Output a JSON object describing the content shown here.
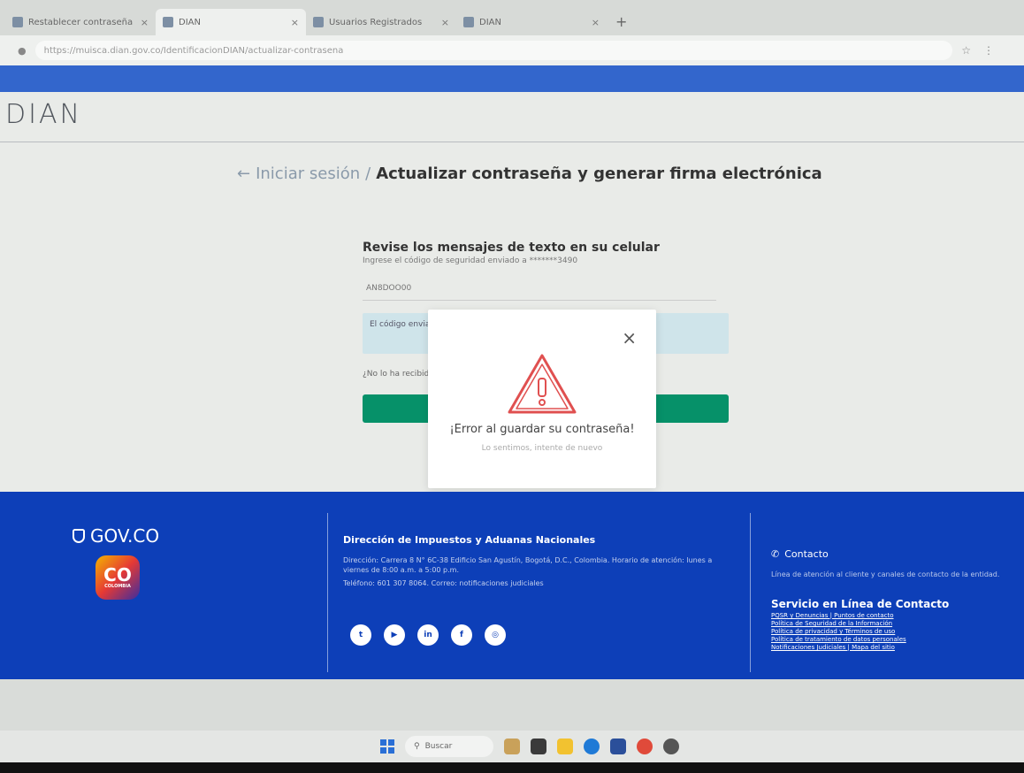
{
  "browser": {
    "tabs": [
      {
        "title": "Restablecer contraseña - DIAN"
      },
      {
        "title": "DIAN"
      },
      {
        "title": "Usuarios Registrados"
      },
      {
        "title": "DIAN"
      }
    ],
    "url": "https://muisca.dian.gov.co/IdentificacionDIAN/actualizar-contrasena"
  },
  "site": {
    "logo": "DIAN"
  },
  "breadcrumb": {
    "back_arrow": "←",
    "back_label": "Iniciar sesión",
    "separator": "/",
    "current": "Actualizar contraseña y generar firma electrónica"
  },
  "form": {
    "title": "Revise los mensajes de texto en su celular",
    "hint": "Ingrese el código de seguridad enviado a *******3490",
    "code_placeholder": "AN8DOO00",
    "info_text": "El código enviado a su celular tiene una vigencia limitada.",
    "resend_text": "¿No lo ha recibido?"
  },
  "modal": {
    "close": "×",
    "icon": "warning-triangle-icon",
    "title": "¡Error al guardar su contraseña!",
    "subtitle": "Lo sentimos, intente de nuevo"
  },
  "footer": {
    "gov_logo": "GOV.CO",
    "co_badge": "CO",
    "co_badge_sub": "COLOMBIA",
    "entity_title": "Dirección de Impuestos y Aduanas Nacionales",
    "entity_text_1": "Dirección: Carrera 8 N° 6C-38 Edificio San Agustín, Bogotá, D.C., Colombia. Horario de atención: lunes a viernes de 8:00 a.m. a 5:00 p.m.",
    "entity_text_2": "Teléfono: 601 307 8064. Correo: notificaciones judiciales",
    "social": [
      {
        "name": "twitter-icon",
        "glyph": "t"
      },
      {
        "name": "youtube-icon",
        "glyph": "▶"
      },
      {
        "name": "linkedin-icon",
        "glyph": "in"
      },
      {
        "name": "facebook-icon",
        "glyph": "f"
      },
      {
        "name": "instagram-icon",
        "glyph": "◎"
      }
    ],
    "contact_title": "Contacto",
    "contact_text": "Línea de atención al cliente y canales de contacto de la entidad.",
    "service_title": "Servicio en Línea de Contacto",
    "links": [
      "PQSR y Denuncias | Puntos de contacto",
      "Política de Seguridad de la Información",
      "Política de privacidad y Términos de uso",
      "Política de tratamiento de datos personales",
      "Notificaciones Judiciales | Mapa del sitio"
    ]
  },
  "taskbar": {
    "search_label": "Buscar"
  }
}
